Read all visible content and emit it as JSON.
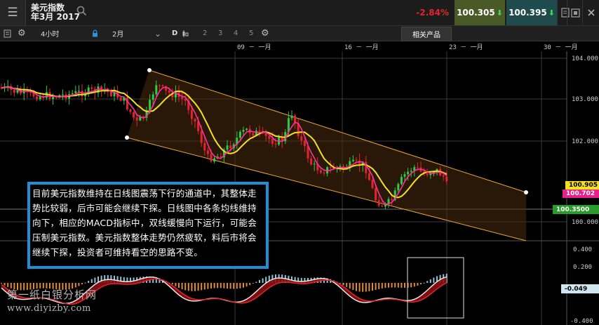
{
  "header": {
    "instrument": "美元指数",
    "contract": "年3月 2017",
    "change_pct": "-2.84%",
    "sell_price": "100.305",
    "buy_price": "100.395"
  },
  "toolbar": {
    "timeframe": "4小时",
    "period": "2月",
    "draw_label": "D",
    "layout_numbers": [
      "2",
      "3",
      "4",
      "5"
    ],
    "related_products": "相关产品"
  },
  "date_axis": {
    "labels": [
      "09 － 一月",
      "16 － 一月",
      "23 － 一月",
      "30 － 一月"
    ]
  },
  "price_axis": {
    "main_ticks": [
      "104.000",
      "103.000",
      "102.000",
      "100.000"
    ],
    "macd_ticks": [
      "0.400",
      "0.200",
      "-0.400"
    ]
  },
  "price_tags": {
    "tag1": "100.905",
    "tag2": "100.702",
    "tag3": "100.3500",
    "macd_tag": "-0.049"
  },
  "annotation": {
    "text": "目前美元指数维持在日线图震荡下行的通道中，其整体走势比较弱，后市可能会继续下探。日线图中各条均线维持向下，相应的MACD指标中，双线缓慢向下运行，可能会压制美元指数。美元指数整体走势仍然疲软，料后市将会继续下探，投资者可维持看空的思路不变。"
  },
  "watermark": {
    "line1": "第一纸白银分析网",
    "line2": "www.diyizby.com"
  },
  "colors": {
    "up_candle": "#2ecc40",
    "down_candle": "#e0262c",
    "ma_fast": "#ff2ea0",
    "ma_slow": "#f2e021",
    "channel": "#e8a33a",
    "annotation_border": "#1c8fd6"
  },
  "icons": {
    "menu": "hamburger-icon",
    "search": "search-icon",
    "watchlist": "watchlist-icon",
    "window": "window-icon",
    "close": "close-icon",
    "settings": "gear-icon",
    "lock": "lock-icon"
  }
}
